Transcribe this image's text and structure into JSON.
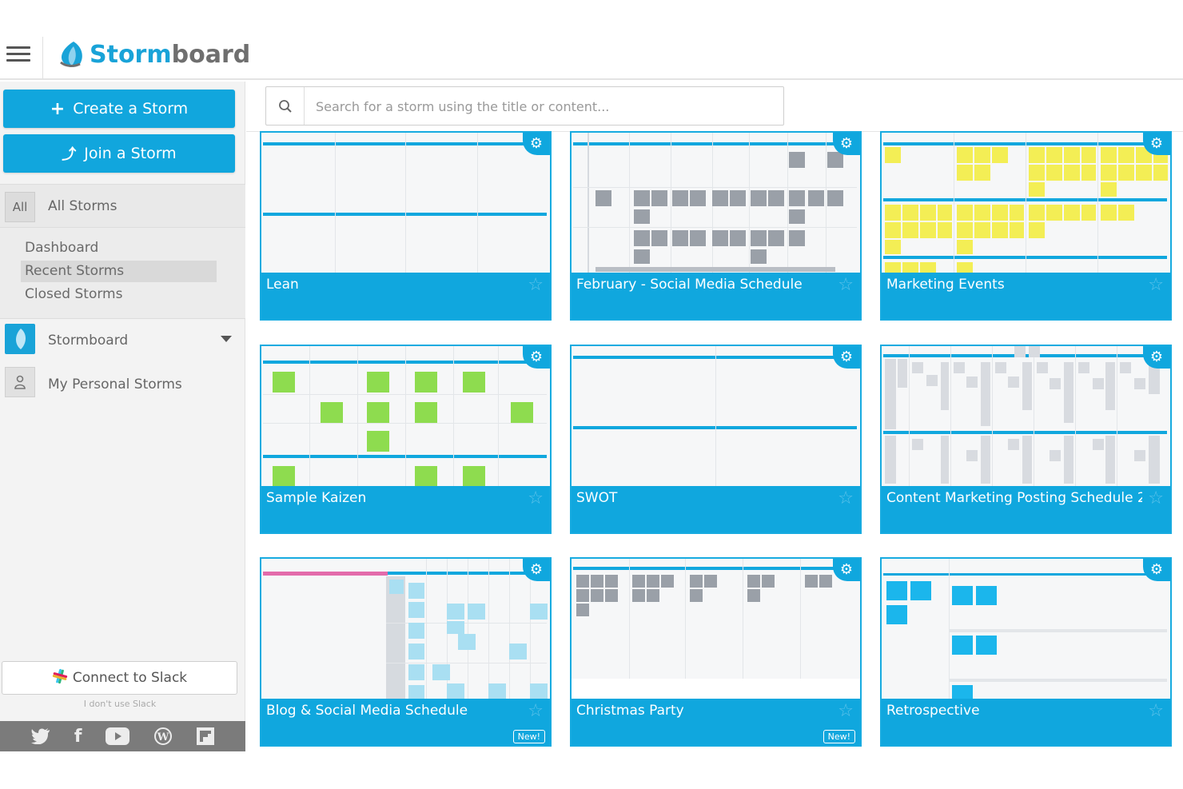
{
  "app": {
    "brand_left": "Storm",
    "brand_right": "board",
    "brand_color": "#19a3d8",
    "accent": "#11a6dd"
  },
  "sidebar": {
    "create_label": "Create a Storm",
    "join_label": "Join a Storm",
    "all_badge": "All",
    "all_label": "All Storms",
    "nav": [
      {
        "label": "Dashboard"
      },
      {
        "label": "Recent Storms"
      },
      {
        "label": "Closed Storms"
      }
    ],
    "org_label": "Stormboard",
    "personal_label": "My Personal Storms",
    "slack_label": "Connect to Slack",
    "slack_sub": "I don't use Slack",
    "social_icons": [
      "twitter-icon",
      "facebook-icon",
      "youtube-icon",
      "wordpress-icon",
      "flipboard-icon"
    ]
  },
  "search": {
    "placeholder": "Search for a storm using the title or content..."
  },
  "storms": [
    {
      "title": "Lean",
      "new": false
    },
    {
      "title": "February - Social Media Schedule",
      "new": false
    },
    {
      "title": "Marketing Events",
      "new": false
    },
    {
      "title": "Sample Kaizen",
      "new": false
    },
    {
      "title": "SWOT",
      "new": false
    },
    {
      "title": "Content Marketing Posting Schedule 2...",
      "new": false
    },
    {
      "title": "Blog & Social Media Schedule",
      "new": true
    },
    {
      "title": "Christmas Party",
      "new": true
    },
    {
      "title": "Retrospective",
      "new": false
    }
  ],
  "badges": {
    "new_label": "New!"
  },
  "colors": {
    "yellow_note": "#f3ee55",
    "green_note": "#8edc4f",
    "gray_note": "#9aa0a8",
    "light_blue_note": "#a9dff2",
    "cyan_note": "#1bb6ec",
    "pink_header": "#e36bab"
  }
}
